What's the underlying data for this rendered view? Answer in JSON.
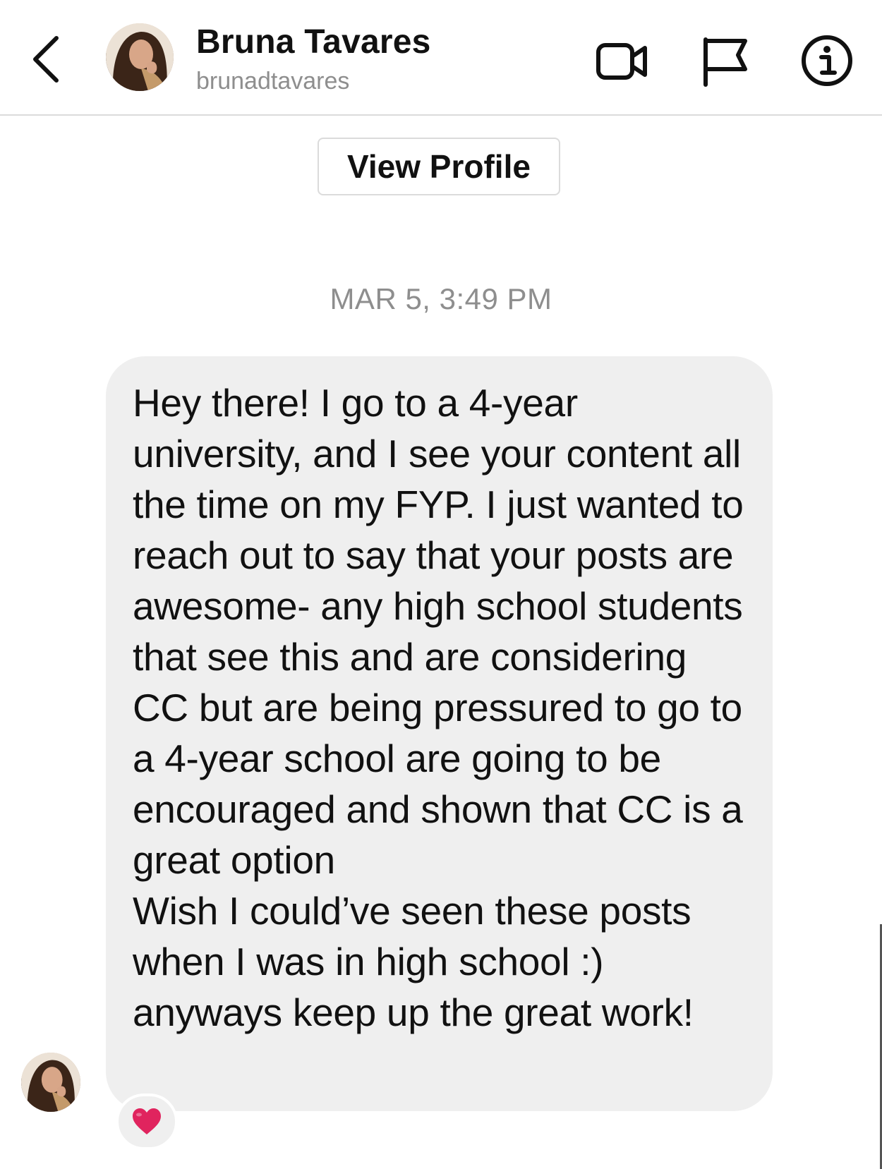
{
  "header": {
    "name": "Bruna Tavares",
    "username": "brunadtavares",
    "icons": {
      "back": "chevron-left-icon",
      "video": "video-camera-icon",
      "report": "flag-icon",
      "info": "info-icon"
    }
  },
  "profile": {
    "view_profile_label": "View Profile"
  },
  "conversation": {
    "timestamp": "MAR 5, 3:49 PM",
    "messages": [
      {
        "text": "Hey there! I go to a 4-year university, and I see your content all the time on my FYP. I just wanted to reach out to say that your posts are awesome- any high school students that see this and are considering CC but are being pressured to go to a 4-year school are going to be encouraged and shown that CC is a great option\nWish I could’ve seen these posts when I was in high school :)\nanyways keep up the great work!",
        "reaction": "red-heart-icon"
      }
    ]
  },
  "colors": {
    "bubble": "#efefef",
    "secondary_text": "#8e8e8e",
    "divider": "#dbdbdb",
    "heart": "#e0245e"
  }
}
